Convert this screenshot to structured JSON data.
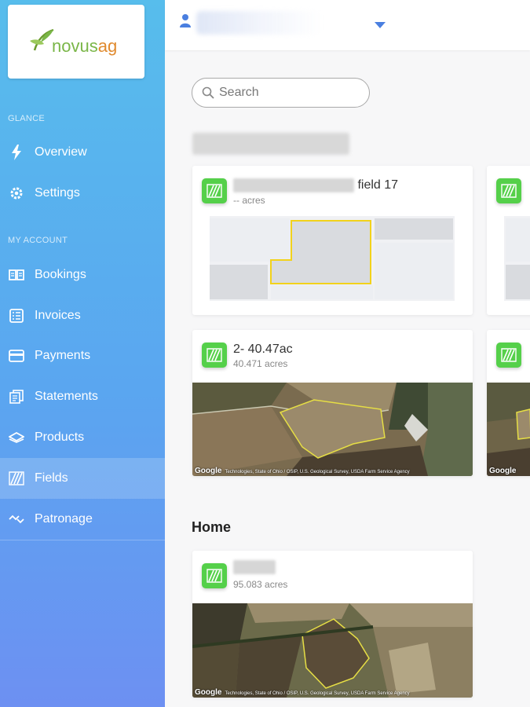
{
  "brand": {
    "logo_text_a": "novus",
    "logo_text_b": "ag",
    "colors": {
      "green": "#7ab648",
      "orange": "#e08a2e",
      "sidebar_top": "#57bdec",
      "sidebar_bottom": "#6d90f2",
      "field_icon": "#55d04a",
      "outline": "#f2d21b"
    }
  },
  "sidebar": {
    "sections": [
      {
        "label": "GLANCE",
        "items": [
          {
            "label": "Overview",
            "icon": "lightning-icon"
          },
          {
            "label": "Settings",
            "icon": "gear-icon"
          }
        ]
      },
      {
        "label": "MY ACCOUNT",
        "items": [
          {
            "label": "Bookings",
            "icon": "book-icon"
          },
          {
            "label": "Invoices",
            "icon": "invoice-icon"
          },
          {
            "label": "Payments",
            "icon": "card-icon"
          },
          {
            "label": "Statements",
            "icon": "statement-icon"
          },
          {
            "label": "Products",
            "icon": "products-icon"
          },
          {
            "label": "Fields",
            "icon": "fields-icon",
            "active": true
          },
          {
            "label": "Patronage",
            "icon": "patronage-icon"
          }
        ]
      }
    ]
  },
  "topbar": {
    "user_icon": "user-icon",
    "dropdown_icon": "caret-down-icon"
  },
  "search": {
    "placeholder": "Search",
    "value": ""
  },
  "groups": [
    {
      "title": "",
      "cards": [
        {
          "name_suffix": "field 17",
          "acres": "-- acres",
          "map": "placeholder"
        },
        {
          "name": "",
          "acres": "",
          "map": "placeholder"
        },
        {
          "name": "2- 40.47ac",
          "acres": "40.471 acres",
          "map": "satellite"
        },
        {
          "name": "",
          "acres": "",
          "map": "satellite"
        }
      ]
    },
    {
      "title": "Home",
      "cards": [
        {
          "name": "",
          "acres": "95.083 acres",
          "map": "satellite"
        }
      ]
    }
  ],
  "map_attribution": {
    "logo": "Google",
    "credits": "Technologies, State of Ohio / OSIP, U.S. Geological Survey, USDA Farm Service Agency"
  }
}
